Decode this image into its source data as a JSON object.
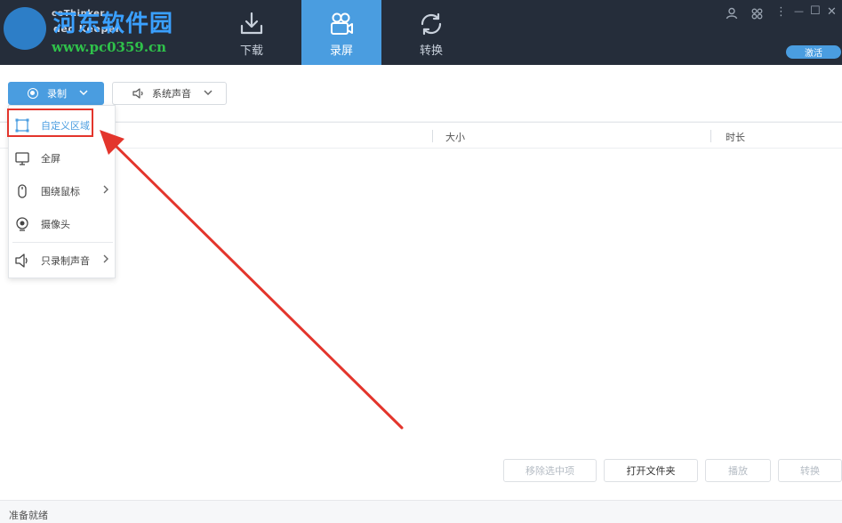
{
  "brand": {
    "app_name_top": "ceThinker",
    "app_name_bottom": "deo Keeper",
    "watermark_cn": "河东软件园",
    "watermark_url": "www.pc0359.cn"
  },
  "nav_tabs": [
    {
      "label": "下载",
      "icon": "download-icon",
      "active": false
    },
    {
      "label": "录屏",
      "icon": "video-camera-icon",
      "active": true
    },
    {
      "label": "转换",
      "icon": "convert-icon",
      "active": false
    }
  ],
  "window_controls": {
    "user_icon": "user-icon",
    "settings_icon": "apps-icon",
    "more": "⋮",
    "minimize": "—",
    "maximize": "☐",
    "close": "✕",
    "activate_label": "激活"
  },
  "toolbar": {
    "record_label": "录制",
    "sound_label": "系统声音"
  },
  "table": {
    "columns": [
      "大小",
      "时长"
    ]
  },
  "record_menu": {
    "items": [
      {
        "label": "自定义区域",
        "icon": "custom-region-icon",
        "has_submenu": false,
        "selected": true
      },
      {
        "label": "全屏",
        "icon": "monitor-icon",
        "has_submenu": false,
        "selected": false
      },
      {
        "label": "围绕鼠标",
        "icon": "mouse-icon",
        "has_submenu": true,
        "selected": false
      },
      {
        "label": "摄像头",
        "icon": "webcam-icon",
        "has_submenu": false,
        "selected": false
      },
      {
        "label": "只录制声音",
        "icon": "speaker-icon",
        "has_submenu": true,
        "selected": false
      }
    ]
  },
  "bottom_buttons": {
    "remove_selected": "移除选中项",
    "open_folder": "打开文件夹",
    "play": "播放",
    "convert": "转换"
  },
  "status": {
    "text": "准备就绪"
  },
  "colors": {
    "topbar": "#252d3a",
    "accent": "#4a9de0",
    "annotation_red": "#e3352c"
  }
}
